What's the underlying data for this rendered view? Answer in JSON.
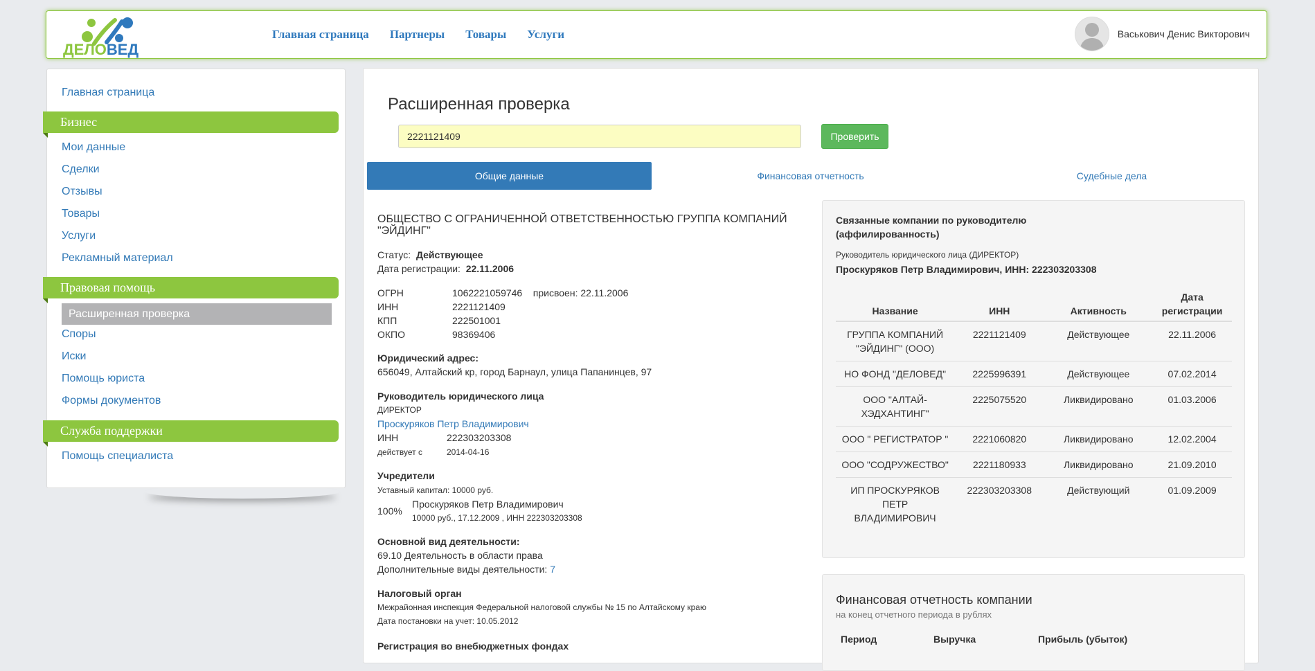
{
  "logo": {
    "part1": "ДЕЛО",
    "part2": "ВЕД"
  },
  "topnav": [
    "Главная страница",
    "Партнеры",
    "Товары",
    "Услуги"
  ],
  "user": {
    "name": "Васькович Денис Викторович"
  },
  "sidebar": {
    "home": "Главная страница",
    "business_header": "Бизнес",
    "business_items": [
      "Мои данные",
      "Сделки",
      "Отзывы",
      "Товары",
      "Услуги",
      "Рекламный материал"
    ],
    "legal_header": "Правовая помощь",
    "legal_active": "Расширенная проверка",
    "legal_items": [
      "Споры",
      "Иски",
      "Помощь юриста",
      "Формы документов"
    ],
    "support_header": "Служба поддержки",
    "support_items": [
      "Помощь специалиста"
    ]
  },
  "main": {
    "title": "Расширенная проверка",
    "search_value": "2221121409",
    "check_button": "Проверить",
    "tabs": [
      "Общие данные",
      "Финансовая отчетность",
      "Судебные дела"
    ]
  },
  "company": {
    "name": "ОБЩЕСТВО С ОГРАНИЧЕННОЙ ОТВЕТСТВЕННОСТЬЮ ГРУППА КОМПАНИЙ \"ЭЙДИНГ\"",
    "status_label": "Статус:",
    "status_value": "Действующее",
    "reg_label": "Дата регистрации:",
    "reg_value": "22.11.2006",
    "ogrn_label": "ОГРН",
    "ogrn_value": "1062221059746",
    "ogrn_assigned": "присвоен: 22.11.2006",
    "inn_label": "ИНН",
    "inn_value": "2221121409",
    "kpp_label": "КПП",
    "kpp_value": "222501001",
    "okpo_label": "ОКПО",
    "okpo_value": "98369406",
    "address_label": "Юридический адрес:",
    "address_value": "656049, Алтайский кр, город Барнаул, улица Папанинцев, 97",
    "head_label": "Руководитель юридического лица",
    "head_role": "ДИРЕКТОР",
    "head_name": "Проскуряков Петр Владимирович",
    "head_inn_label": "ИНН",
    "head_inn_value": "222303203308",
    "head_since_label": "действует с",
    "head_since_value": "2014-04-16",
    "founders_label": "Учредители",
    "capital": "Уставный капитал: 10000 руб.",
    "founder_share": "100%",
    "founder_name": "Проскуряков Петр Владимирович",
    "founder_details": "10000 руб., 17.12.2009 , ИНН 222303203308",
    "activity_label": "Основной вид деятельности:",
    "activity_value": "69.10 Деятельность в области права",
    "extra_activity_label": "Дополнительные виды деятельности:",
    "extra_activity_count": "7",
    "tax_label": "Налоговый орган",
    "tax_value": "Межрайонная инспекция Федеральной налоговой службы № 15 по Алтайскому краю",
    "tax_date": "Дата постановки на учет: 10.05.2012",
    "funds_label": "Регистрация во внебюджетных фондах"
  },
  "related": {
    "title": "Связанные компании по руководителю (аффилированность)",
    "director_role": "Руководитель юридического лица (ДИРЕКТОР)",
    "director_name": "Проскуряков Петр Владимирович, ИНН: 222303203308",
    "columns": [
      "Название",
      "ИНН",
      "Активность",
      "Дата регистрации"
    ],
    "rows": [
      [
        "ГРУППА КОМПАНИЙ \"ЭЙДИНГ\" (ООО)",
        "2221121409",
        "Действующее",
        "22.11.2006"
      ],
      [
        "НО ФОНД \"ДЕЛОВЕД\"",
        "2225996391",
        "Действующее",
        "07.02.2014"
      ],
      [
        "ООО \"АЛТАЙ-ХЭДХАНТИНГ\"",
        "2225075520",
        "Ликвидировано",
        "01.03.2006"
      ],
      [
        "ООО \" РЕГИСТРАТОР \"",
        "2221060820",
        "Ликвидировано",
        "12.02.2004"
      ],
      [
        "ООО \"СОДРУЖЕСТВО\"",
        "2221180933",
        "Ликвидировано",
        "21.09.2010"
      ],
      [
        "ИП ПРОСКУРЯКОВ ПЕТР ВЛАДИМИРОВИЧ",
        "222303203308",
        "Действующий",
        "01.09.2009"
      ]
    ]
  },
  "finance": {
    "title": "Финансовая отчетность компании",
    "subtitle": "на конец отчетного периода в рублях",
    "columns": [
      "Период",
      "Выручка",
      "Прибыль (убыток)"
    ]
  },
  "colors": {
    "brand_green": "#8dc63f",
    "brand_blue": "#2f79bd",
    "button_green": "#5cb85c",
    "tab_active": "#337ab7",
    "search_bg": "#fcfdc2"
  }
}
